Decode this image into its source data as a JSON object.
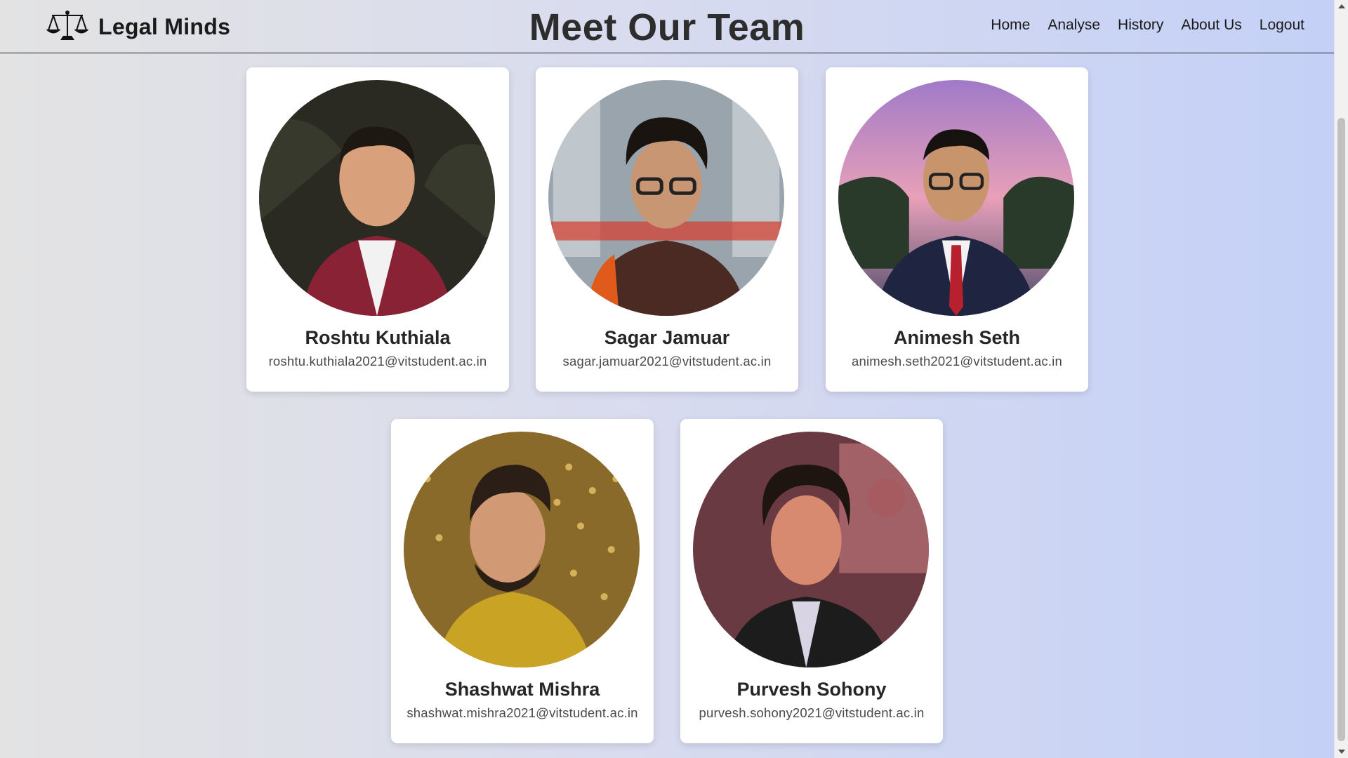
{
  "brand": {
    "name": "Legal Minds",
    "icon": "scales-of-justice-icon"
  },
  "header": {
    "title": "Meet Our Team"
  },
  "nav": {
    "items": [
      {
        "label": "Home"
      },
      {
        "label": "Analyse"
      },
      {
        "label": "History"
      },
      {
        "label": "About Us"
      },
      {
        "label": "Logout"
      }
    ]
  },
  "team": {
    "members": [
      {
        "name": "Roshtu Kuthiala",
        "email": "roshtu.kuthiala2021@vitstudent.ac.in",
        "photo_bg": "#2a2a22",
        "jacket": "#8a2236"
      },
      {
        "name": "Sagar Jamuar",
        "email": "sagar.jamuar2021@vitstudent.ac.in",
        "photo_bg": "#9aa4ad",
        "jacket": "#4a2a22"
      },
      {
        "name": "Animesh Seth",
        "email": "animesh.seth2021@vitstudent.ac.in",
        "photo_bg": "#b98ab8",
        "jacket": "#1f2540"
      },
      {
        "name": "Shashwat Mishra",
        "email": "shashwat.mishra2021@vitstudent.ac.in",
        "photo_bg": "#8a6a2a",
        "jacket": "#c9a323"
      },
      {
        "name": "Purvesh Sohony",
        "email": "purvesh.sohony2021@vitstudent.ac.in",
        "photo_bg": "#6a3a42",
        "jacket": "#1c1c1c"
      }
    ]
  }
}
